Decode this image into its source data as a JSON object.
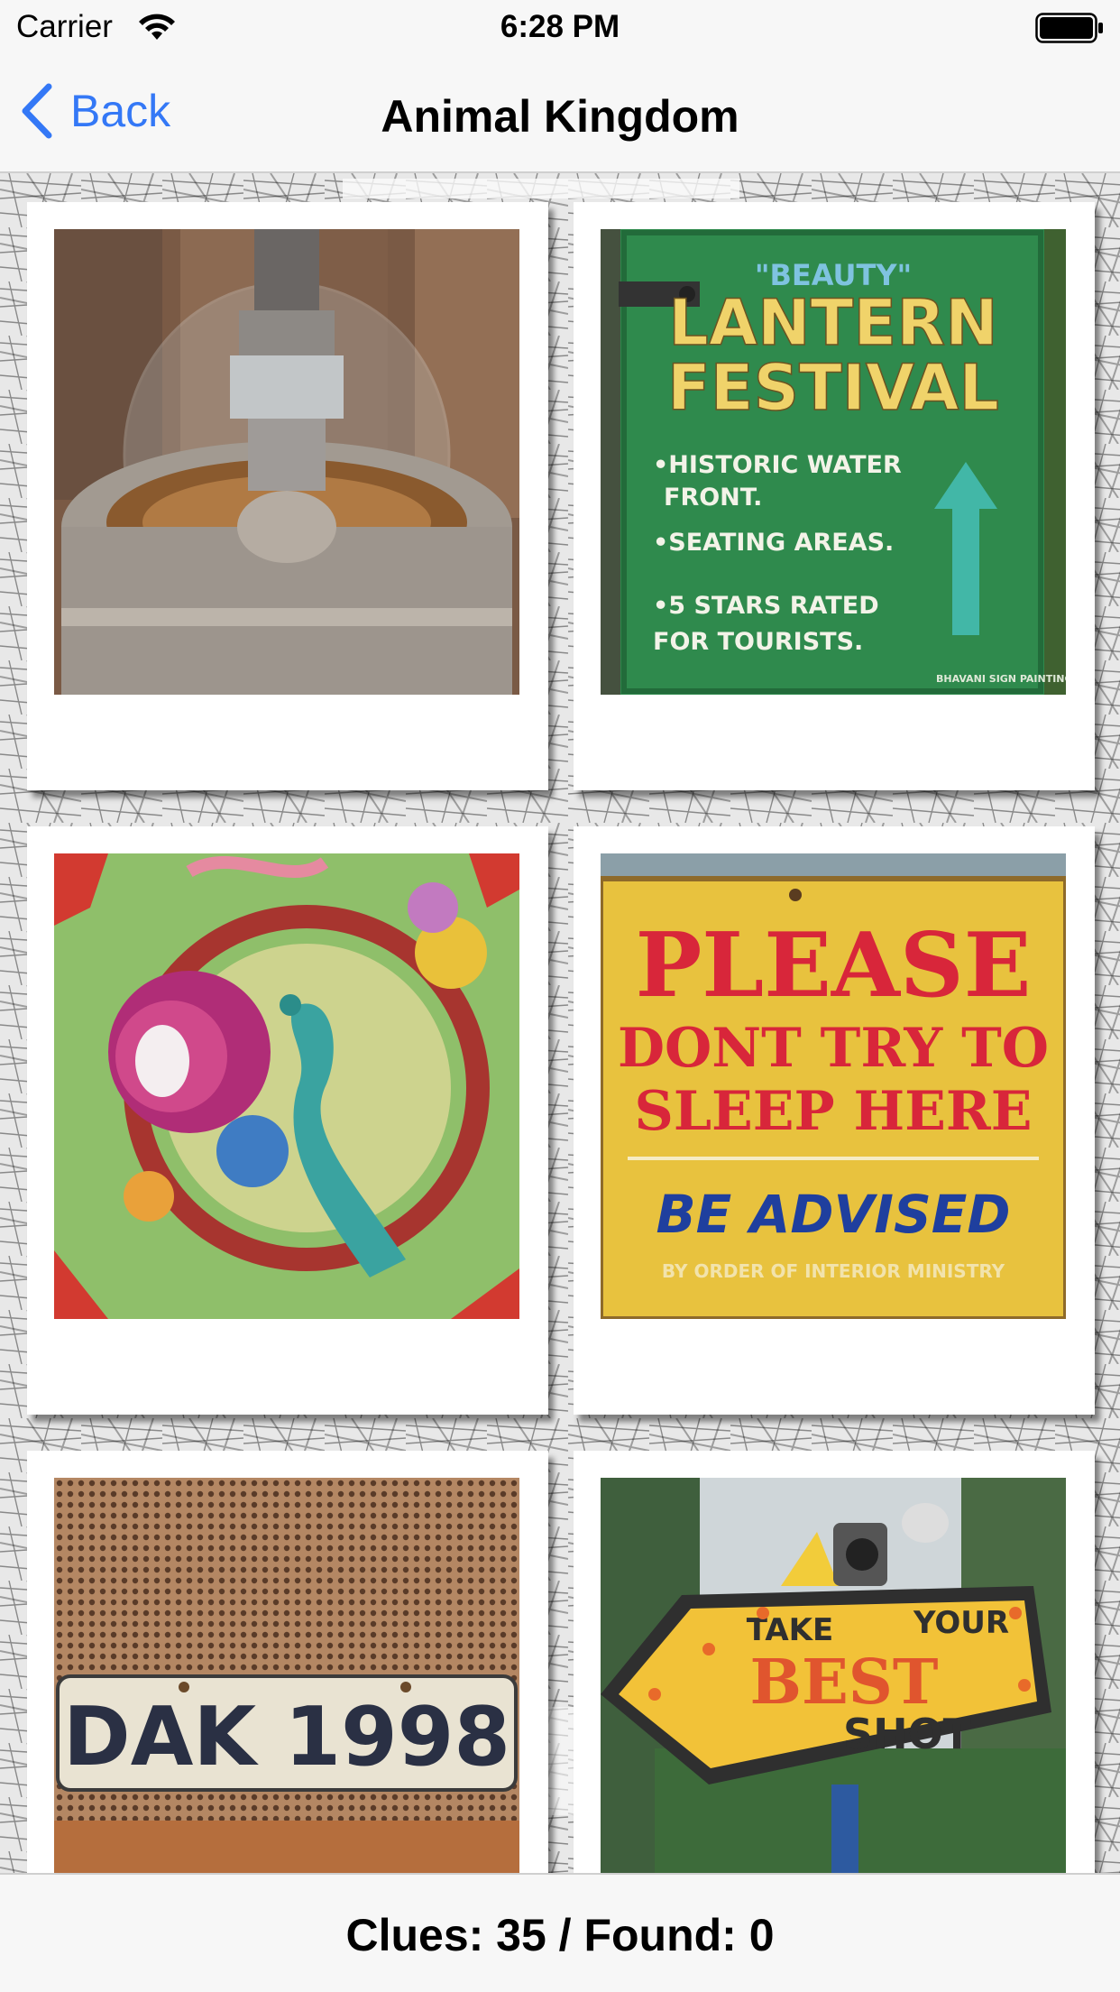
{
  "status_bar": {
    "carrier": "Carrier",
    "time": "6:28 PM",
    "icons": [
      "wifi-icon",
      "battery-icon"
    ]
  },
  "nav": {
    "back_label": "Back",
    "title": "Animal Kingdom",
    "back_icon": "chevron-left-icon",
    "accent_color": "#3478f6"
  },
  "photos": [
    {
      "subject": "fountain"
    },
    {
      "subject": "lantern-festival-sign",
      "text": [
        "\"BEAUTY\"",
        "LANTERN",
        "FESTIVAL",
        "•HISTORIC WATER",
        "FRONT.",
        "•SEATING AREAS.",
        "•5 STARS RATED",
        "FOR TOURISTS.",
        "BHAVANI SIGN PAINTING"
      ]
    },
    {
      "subject": "peacock-painting"
    },
    {
      "subject": "please-sign",
      "text": [
        "PLEASE",
        "DONT TRY TO",
        "SLEEP HERE",
        "BE ADVISED",
        "BY ORDER OF INTERIOR MINISTRY"
      ]
    },
    {
      "subject": "license-plate",
      "text": [
        "DAK 1998"
      ]
    },
    {
      "subject": "photo-sign",
      "text": [
        "TAKE",
        "YOUR",
        "BEST",
        "SHOT"
      ]
    }
  ],
  "footer": {
    "status": "Clues: 35 / Found: 0"
  }
}
